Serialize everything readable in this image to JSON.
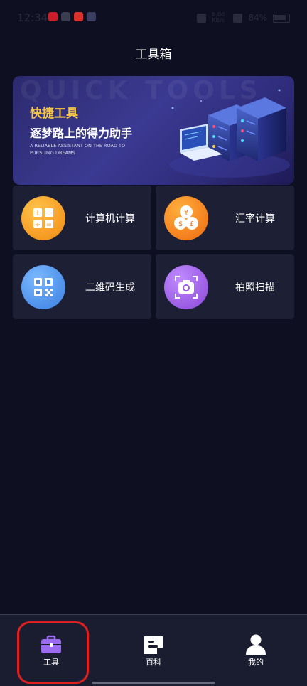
{
  "status_bar": {
    "time": "12:34",
    "battery": "84%",
    "network": "8.00 KB/s"
  },
  "header": {
    "title": "工具箱"
  },
  "banner": {
    "watermark": "QUICK TOOLS",
    "title": "快捷工具",
    "subtitle": "逐梦路上的得力助手",
    "tagline": "A RELIABLE ASSISTANT ON THE ROAD TO PURSUING DREAMS"
  },
  "tools": [
    {
      "label": "计算机计算",
      "icon": "calculator-icon",
      "color": "#f6a01e"
    },
    {
      "label": "汇率计算",
      "icon": "currency-exchange-icon",
      "color": "#f08a1a"
    },
    {
      "label": "二维码生成",
      "icon": "qr-code-icon",
      "color": "#4a90e8"
    },
    {
      "label": "拍照扫描",
      "icon": "camera-scan-icon",
      "color": "#a05ce0"
    }
  ],
  "tab_bar": {
    "items": [
      {
        "label": "工具",
        "icon": "toolbox-icon",
        "active": true
      },
      {
        "label": "百科",
        "icon": "encyclopedia-icon",
        "active": false
      },
      {
        "label": "我的",
        "icon": "profile-icon",
        "active": false
      }
    ]
  },
  "colors": {
    "background": "#0e1022",
    "card": "#1d1f34",
    "accent_purple": "#9b6bf0",
    "banner_title": "#f5c64a"
  }
}
